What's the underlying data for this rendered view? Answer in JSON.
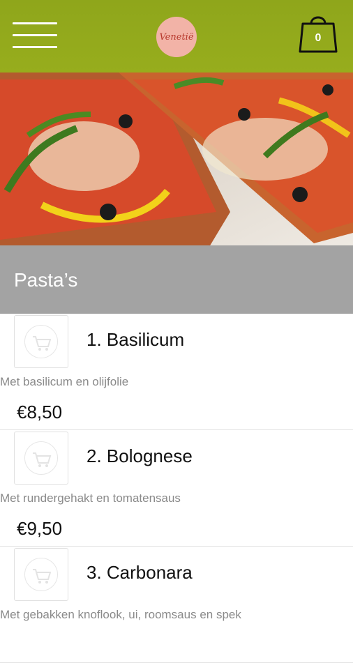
{
  "header": {
    "logo_text": "Venetië",
    "cart_count": "0",
    "accent_color": "#94ab1c",
    "icons": [
      "menu-icon",
      "shopping-bag-icon"
    ]
  },
  "hero": {
    "image": "pizza photo"
  },
  "section": {
    "title": "Pasta’s"
  },
  "items": [
    {
      "name": "1. Basilicum",
      "description": "Met basilicum en olijfolie",
      "price": "€8,50"
    },
    {
      "name": "2. Bolognese",
      "description": "Met rundergehakt en tomatensaus",
      "price": "€9,50"
    },
    {
      "name": "3. Carbonara",
      "description": "Met gebakken knoflook, ui, roomsaus en spek",
      "price": ""
    }
  ]
}
